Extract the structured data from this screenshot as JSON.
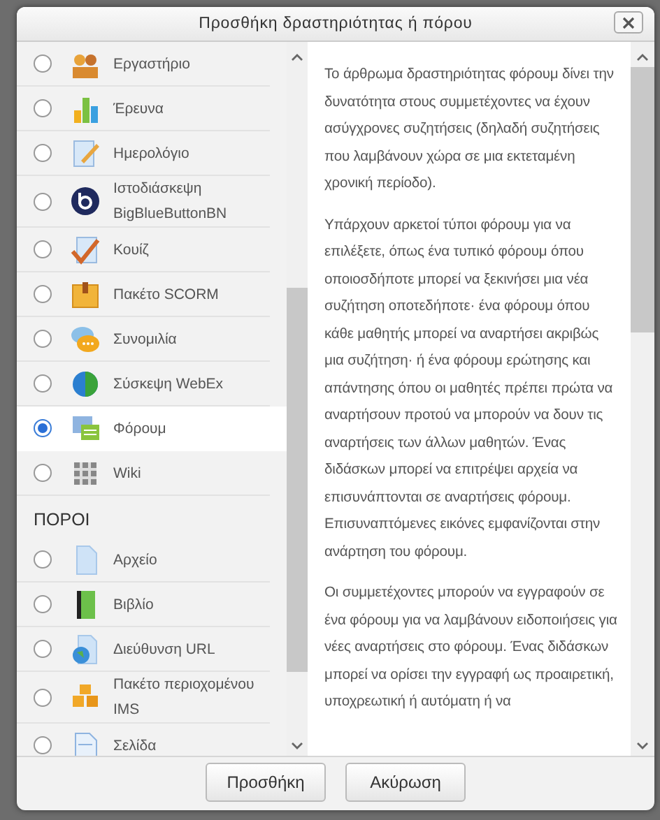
{
  "dialog": {
    "title": "Προσθήκη δραστηριότητας ή πόρου"
  },
  "groups": [
    {
      "items": [
        {
          "label": "Εργαστήριο",
          "selected": false
        },
        {
          "label": "Έρευνα",
          "selected": false
        },
        {
          "label": "Ημερολόγιο",
          "selected": false
        },
        {
          "label": "Ιστοδιάσκεψη BigBlueButtonBN",
          "selected": false
        },
        {
          "label": "Κουίζ",
          "selected": false
        },
        {
          "label": "Πακέτο SCORM",
          "selected": false
        },
        {
          "label": "Συνομιλία",
          "selected": false
        },
        {
          "label": "Σύσκεψη WebEx",
          "selected": false
        },
        {
          "label": "Φόρουμ",
          "selected": true
        },
        {
          "label": "Wiki",
          "selected": false
        }
      ]
    },
    {
      "heading": "ΠΟΡΟΙ",
      "items": [
        {
          "label": "Αρχείο",
          "selected": false
        },
        {
          "label": "Βιβλίο",
          "selected": false
        },
        {
          "label": "Διεύθυνση URL",
          "selected": false
        },
        {
          "label": "Πακέτο περιοχομένου IMS",
          "selected": false
        },
        {
          "label": "Σελίδα",
          "selected": false
        }
      ]
    }
  ],
  "description": [
    "Το άρθρωμα δραστηριότητας φόρουμ δίνει την δυνατότητα στους συμμετέχοντες να έχουν ασύγχρονες συζητήσεις (δηλαδή συζητήσεις που λαμβάνουν χώρα σε μια εκτεταμένη χρονική περίοδο).",
    "Υπάρχουν αρκετοί τύποι φόρουμ για να επιλέξετε, όπως ένα τυπικό φόρουμ όπου οποιοσδήποτε μπορεί να ξεκινήσει μια νέα συζήτηση οποτεδήποτε· ένα φόρουμ όπου κάθε μαθητής μπορεί να αναρτήσει ακριβώς μια συζήτηση· ή ένα φόρουμ ερώτησης και απάντησης όπου οι μαθητές πρέπει πρώτα να αναρτήσουν προτού να μπορούν να δουν τις αναρτήσεις των άλλων μαθητών. Ένας διδάσκων μπορεί να επιτρέψει αρχεία να επισυνάπτονται σε αναρτήσεις φόρουμ. Επισυναπτόμενες εικόνες εμφανίζονται στην ανάρτηση του φόρουμ.",
    "Οι συμμετέχοντες μπορούν να εγγραφούν σε ένα φόρουμ για να λαμβάνουν ειδοποιήσεις για νέες αναρτήσεις στο φόρουμ. Ένας διδάσκων μπορεί να ορίσει την εγγραφή ως προαιρετική, υποχρεωτική ή αυτόματη ή να"
  ],
  "buttons": [
    "Προσθήκη",
    "Ακύρωση"
  ]
}
